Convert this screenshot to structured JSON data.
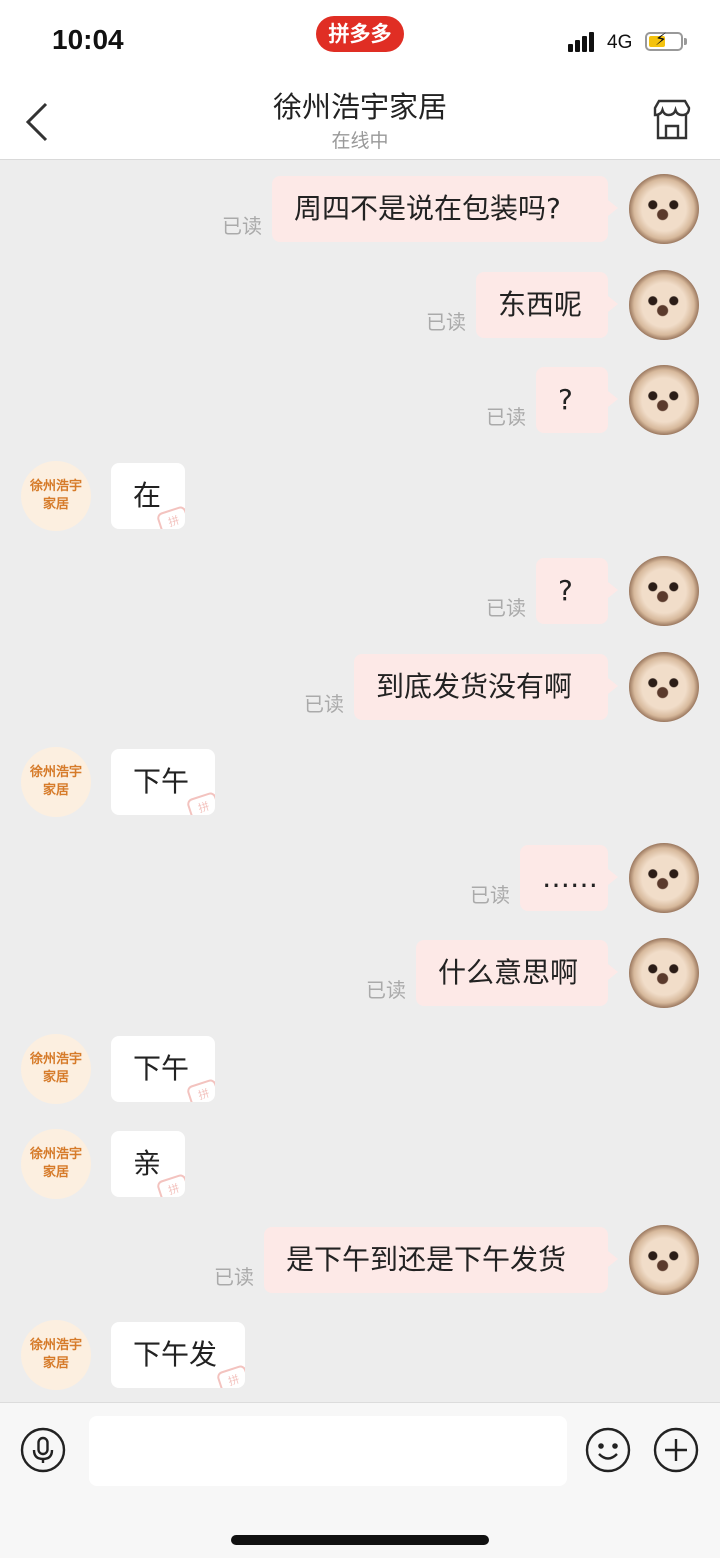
{
  "status_bar": {
    "time": "10:04",
    "app_badge": "拼多多",
    "network": "4G"
  },
  "header": {
    "title": "徐州浩宇家居",
    "subtitle": "在线中"
  },
  "shop_avatar_text": "徐州浩宇家居",
  "read_label": "已读",
  "messages": [
    {
      "side": "out",
      "text": "周四不是说在包装吗?"
    },
    {
      "side": "out",
      "text": "东西呢"
    },
    {
      "side": "out",
      "text": "?"
    },
    {
      "side": "in",
      "text": "在"
    },
    {
      "side": "out",
      "text": "?"
    },
    {
      "side": "out",
      "text": "到底发货没有啊"
    },
    {
      "side": "in",
      "text": "下午"
    },
    {
      "side": "out",
      "text": "……"
    },
    {
      "side": "out",
      "text": "什么意思啊"
    },
    {
      "side": "in",
      "text": "下午"
    },
    {
      "side": "in",
      "text": "亲"
    },
    {
      "side": "out",
      "text": "是下午到还是下午发货"
    },
    {
      "side": "in",
      "text": "下午发"
    }
  ],
  "stamp_glyph": "拼",
  "colors": {
    "brand_red": "#e02e24",
    "outgoing_bubble": "#fde9e7",
    "incoming_bubble": "#ffffff",
    "chat_background": "#ededed"
  },
  "icons": [
    "back-icon",
    "store-icon",
    "microphone-icon",
    "emoji-icon",
    "plus-icon"
  ]
}
